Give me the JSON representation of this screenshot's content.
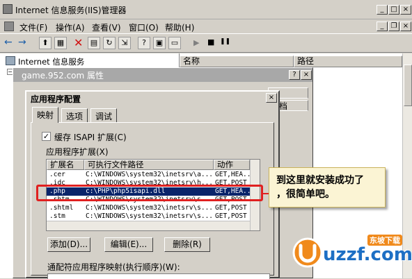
{
  "main_window": {
    "title": "Internet 信息服务(IIS)管理器",
    "min": "_",
    "max": "□",
    "close": "×"
  },
  "menu": {
    "items": [
      "文件(F)",
      "操作(A)",
      "查看(V)",
      "窗口(O)",
      "帮助(H)"
    ],
    "mdi_min": "_",
    "mdi_restore": "❐",
    "mdi_close": "×"
  },
  "toolbar": {
    "back": "←",
    "forward": "→",
    "play": "▶",
    "stop": "■",
    "pause": "❚❚"
  },
  "tree": {
    "root_label": "Internet 信息服务"
  },
  "list": {
    "col_name": "名称",
    "col_path": "路径"
  },
  "props_dialog": {
    "title": "game.952.com 属性",
    "help": "?",
    "close": "×",
    "bg_text": "档"
  },
  "appcfg_dialog": {
    "title": "应用程序配置",
    "close": "×",
    "tabs": [
      "映射",
      "选项",
      "调试"
    ],
    "cache_label": "缓存 ISAPI 扩展(C)",
    "cache_checked": true,
    "ext_group_label": "应用程序扩展(X)",
    "columns": [
      "扩展名",
      "可执行文件路径",
      "动作"
    ],
    "rows": [
      {
        "ext": ".cer",
        "path": "C:\\WINDOWS\\system32\\inetsrv\\a...",
        "action": "GET,HEA..."
      },
      {
        "ext": ".idc",
        "path": "C:\\WINDOWS\\system32\\inetsrv\\h...",
        "action": "GET,POST"
      },
      {
        "ext": ".php",
        "path": "c:\\PHP\\php5isapi.dll",
        "action": "GET,HEA..."
      },
      {
        "ext": ".shtm",
        "path": "C:\\WINDOWS\\system32\\inetsrv\\s...",
        "action": "GET,POST"
      },
      {
        "ext": ".shtml",
        "path": "C:\\WINDOWS\\system32\\inetsrv\\s...",
        "action": "GET,POST"
      },
      {
        "ext": ".stm",
        "path": "C:\\WINDOWS\\system32\\inetsrv\\s...",
        "action": "GET,POST"
      }
    ],
    "add_button": "添加(D)...",
    "edit_button": "编辑(E)...",
    "delete_button": "删除(R)",
    "wildcard_label": "通配符应用程序映射(执行顺序)(W):"
  },
  "annotation": {
    "line1": "到这里就安装成功了",
    "line2": "，很简单吧。"
  },
  "watermark": {
    "brand": "uzzf.com",
    "cn_label": "东坡下载"
  },
  "colors": {
    "selection": "#0a246a",
    "highlight_box": "#e02020",
    "callout_bg": "#fbf4d4",
    "watermark_orange": "#f08a1c",
    "watermark_blue": "#1d6fc4"
  }
}
